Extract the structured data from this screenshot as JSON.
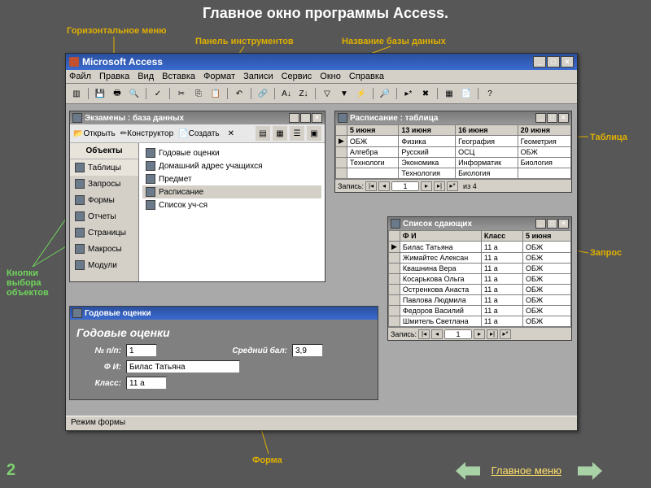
{
  "slide": {
    "title": "Главное окно программы Access.",
    "page_num": "2",
    "footer_link": "Главное меню"
  },
  "annots": {
    "hmenu": "Горизонтальное меню",
    "toolbar": "Панель инструментов",
    "dbname": "Название базы данных",
    "table": "Таблица",
    "query": "Запрос",
    "objbtns": "Кнопки выбора объектов",
    "form": "Форма"
  },
  "app": {
    "title": "Microsoft Access",
    "menu": [
      "Файл",
      "Правка",
      "Вид",
      "Вставка",
      "Формат",
      "Записи",
      "Сервис",
      "Окно",
      "Справка"
    ],
    "status": "Режим формы"
  },
  "dbwin": {
    "title": "Экзамены : база данных",
    "toolbar": {
      "open": "Открыть",
      "design": "Конструктор",
      "create": "Создать"
    },
    "side_head": "Объекты",
    "side": [
      "Таблицы",
      "Запросы",
      "Формы",
      "Отчеты",
      "Страницы",
      "Макросы",
      "Модули"
    ],
    "list": [
      "Годовые оценки",
      "Домашний адрес учащихся",
      "Предмет",
      "Расписание",
      "Список уч-ся"
    ]
  },
  "tablewin": {
    "title": "Расписание : таблица",
    "headers": [
      "5 июня",
      "13 июня",
      "16 июня",
      "20 июня"
    ],
    "rows": [
      [
        "ОБЖ",
        "Физика",
        "География",
        "Геометрия"
      ],
      [
        "Алгебра",
        "Русский",
        "ОСЦ",
        "ОБЖ"
      ],
      [
        "Технологи",
        "Экономика",
        "Информатик",
        "Биология"
      ],
      [
        "",
        "Технология",
        "Биология",
        ""
      ]
    ],
    "recnav": {
      "label": "Запись:",
      "value": "1",
      "of": "из 4"
    }
  },
  "querywin": {
    "title": "Список сдающих",
    "headers": [
      "Ф И",
      "Класс",
      "5 июня"
    ],
    "rows": [
      [
        "Билас Татьяна",
        "11 а",
        "ОБЖ"
      ],
      [
        "Жимайтес Алексан",
        "11 а",
        "ОБЖ"
      ],
      [
        "Квашнина Вера",
        "11 а",
        "ОБЖ"
      ],
      [
        "Косарькова Ольга",
        "11 а",
        "ОБЖ"
      ],
      [
        "Остренкова Анаста",
        "11 а",
        "ОБЖ"
      ],
      [
        "Павлова Людмила",
        "11 а",
        "ОБЖ"
      ],
      [
        "Федоров Василий",
        "11 а",
        "ОБЖ"
      ],
      [
        "Шмитель Светлана",
        "11 а",
        "ОБЖ"
      ]
    ],
    "recnav": {
      "label": "Запись:",
      "value": "1"
    }
  },
  "formwin": {
    "title": "Годовые оценки",
    "header": "Годовые оценки",
    "fields": {
      "num_label": "№ п/п:",
      "num_value": "1",
      "avg_label": "Средний бал:",
      "avg_value": "3,9",
      "fio_label": "Ф И:",
      "fio_value": "Билас Татьяна",
      "class_label": "Класс:",
      "class_value": "11 а"
    }
  }
}
